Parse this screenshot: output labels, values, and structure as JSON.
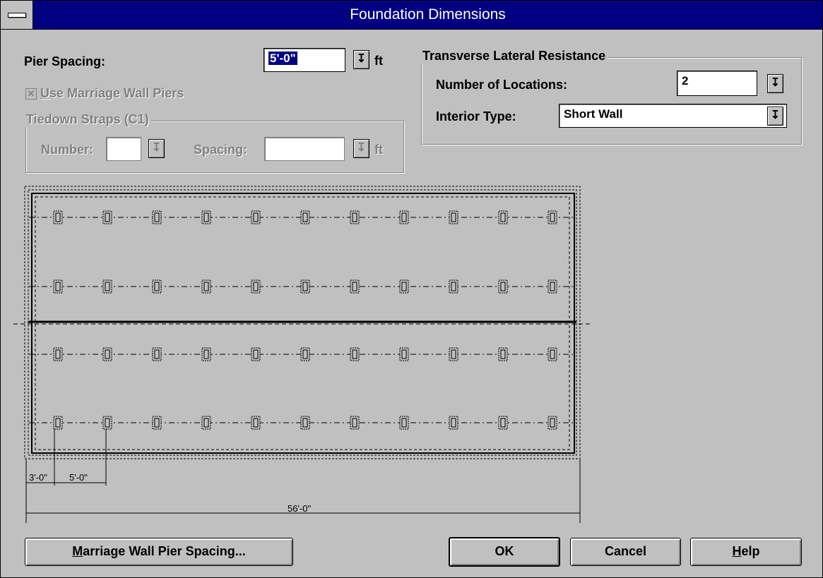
{
  "window": {
    "title": "Foundation Dimensions"
  },
  "pier_spacing": {
    "label": "Pier Spacing:",
    "value": "5'-0\"",
    "unit": "ft"
  },
  "marriage_wall": {
    "label_key": "U",
    "label_rest": "se Marriage Wall Piers",
    "checked": true
  },
  "tiedown": {
    "title": "Tiedown Straps (C1)",
    "number_label": "Number:",
    "number_value": "",
    "spacing_label": "Spacing:",
    "spacing_value": "",
    "unit": "ft"
  },
  "transverse": {
    "title": "Transverse Lateral Resistance",
    "locations_label": "Number of Locations:",
    "locations_value": "2",
    "interior_label": "Interior Type:",
    "interior_value": "Short Wall"
  },
  "diagram": {
    "dim_left": "3'-0\"",
    "dim_spacing": "5'-0\"",
    "dim_total": "56'-0\"",
    "pier_rows": 4,
    "piers_per_row": 11
  },
  "buttons": {
    "marriage_key": "M",
    "marriage_rest": "arriage Wall Pier Spacing...",
    "ok": "OK",
    "cancel": "Cancel",
    "help_key": "H",
    "help_rest": "elp"
  },
  "icons": {
    "spin": "down-arrow-icon",
    "sysmenu": "system-menu-icon"
  }
}
